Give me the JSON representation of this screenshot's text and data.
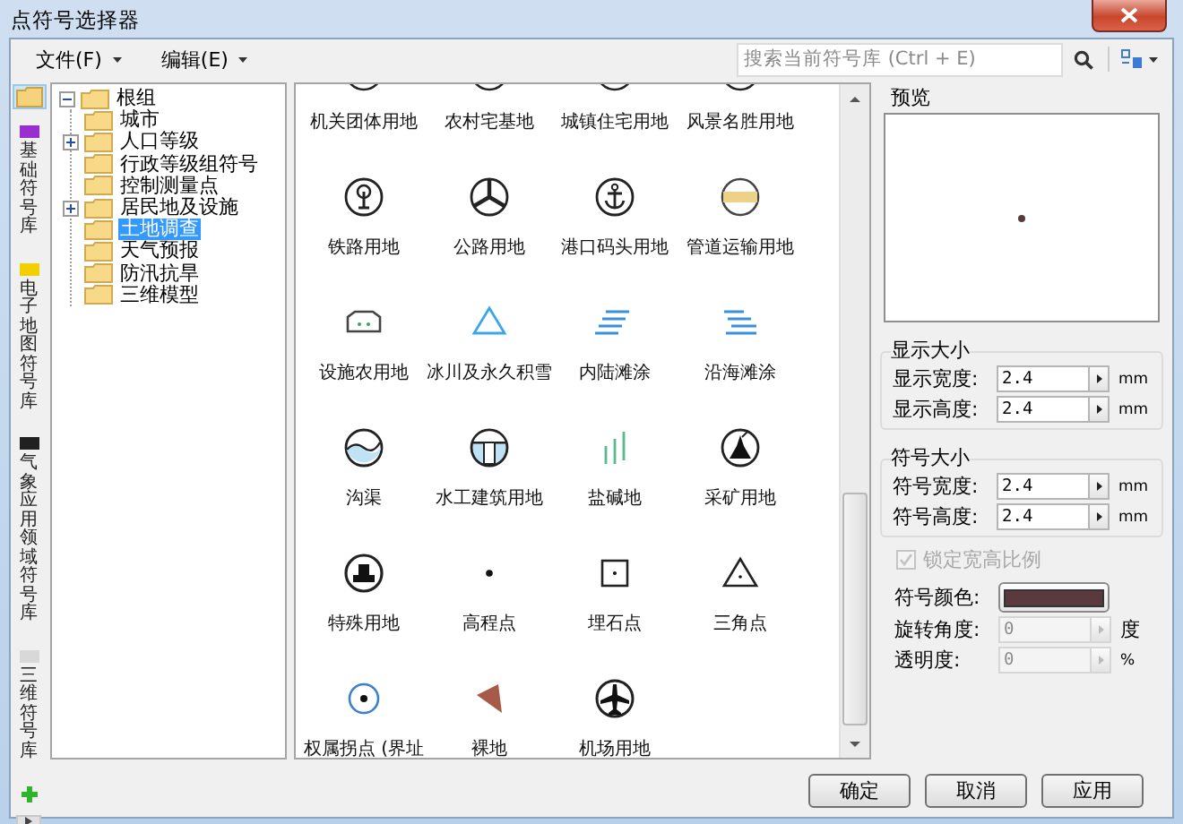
{
  "window": {
    "title": "点符号选择器"
  },
  "menu": [
    {
      "label": "文件(F)"
    },
    {
      "label": "编辑(E)"
    }
  ],
  "search": {
    "placeholder": "搜索当前符号库 (Ctrl + E)"
  },
  "folder_button": {
    "selected": true
  },
  "library_tabs": [
    {
      "label": "基础符号库",
      "color": "#9a2fd0",
      "selected": false
    },
    {
      "label": "电子地图符号库",
      "color": "#f2d000",
      "selected": false
    },
    {
      "label": "气象应用领域符号库",
      "color": "#202020",
      "selected": false
    },
    {
      "label": "三维符号库",
      "color": "#d8d8d8",
      "selected": false
    }
  ],
  "tree": {
    "label": "根组",
    "expanded": true,
    "selected": false,
    "children": [
      {
        "label": "城市",
        "kind": "leaf",
        "selected": false
      },
      {
        "label": "人口等级",
        "kind": "group",
        "selected": false
      },
      {
        "label": "行政等级组符号",
        "kind": "leaf",
        "selected": false
      },
      {
        "label": "控制测量点",
        "kind": "leaf",
        "selected": false
      },
      {
        "label": "居民地及设施",
        "kind": "group",
        "selected": false
      },
      {
        "label": "土地调查",
        "kind": "leaf",
        "selected": true
      },
      {
        "label": "天气预报",
        "kind": "leaf",
        "selected": false
      },
      {
        "label": "防汛抗旱",
        "kind": "leaf",
        "selected": false
      },
      {
        "label": "三维模型",
        "kind": "leaf",
        "selected": false
      }
    ]
  },
  "symbols": [
    {
      "label": "机关团体用地",
      "kind": "cut"
    },
    {
      "label": "农村宅基地",
      "kind": "cut"
    },
    {
      "label": "城镇住宅用地",
      "kind": "cut"
    },
    {
      "label": "风景名胜用地",
      "kind": "cut"
    },
    {
      "label": "铁路用地",
      "kind": "rail"
    },
    {
      "label": "公路用地",
      "kind": "road"
    },
    {
      "label": "港口码头用地",
      "kind": "port"
    },
    {
      "label": "管道运输用地",
      "kind": "pipe"
    },
    {
      "label": "设施农用地",
      "kind": "greenhouse"
    },
    {
      "label": "冰川及永久积雪",
      "kind": "glacier"
    },
    {
      "label": "内陆滩涂",
      "kind": "inland"
    },
    {
      "label": "沿海滩涂",
      "kind": "coastal"
    },
    {
      "label": "沟渠",
      "kind": "ditch"
    },
    {
      "label": "水工建筑用地",
      "kind": "hydraulic"
    },
    {
      "label": "盐碱地",
      "kind": "saline"
    },
    {
      "label": "采矿用地",
      "kind": "mining"
    },
    {
      "label": "特殊用地",
      "kind": "special"
    },
    {
      "label": "高程点",
      "kind": "elevation"
    },
    {
      "label": "埋石点",
      "kind": "stone"
    },
    {
      "label": "三角点",
      "kind": "triangle"
    },
    {
      "label": "权属拐点 (界址",
      "kind": "ownership"
    },
    {
      "label": "裸地",
      "kind": "bare"
    },
    {
      "label": "机场用地",
      "kind": "airport"
    }
  ],
  "properties": {
    "preview_title": "预览",
    "groups": [
      {
        "title": "显示大小",
        "fields": [
          {
            "label": "显示宽度:",
            "value": "2.4",
            "unit": "mm",
            "disabled": false
          },
          {
            "label": "显示高度:",
            "value": "2.4",
            "unit": "mm",
            "disabled": false
          }
        ]
      },
      {
        "title": "符号大小",
        "fields": [
          {
            "label": "符号宽度:",
            "value": "2.4",
            "unit": "mm",
            "disabled": false
          },
          {
            "label": "符号高度:",
            "value": "2.4",
            "unit": "mm",
            "disabled": false
          }
        ]
      }
    ],
    "lock_ratio": {
      "label": "锁定宽高比例",
      "checked": true,
      "disabled": true
    },
    "symbol_color": {
      "label": "符号颜色:",
      "color": "#5a3a3e"
    },
    "fields": [
      {
        "label": "旋转角度:",
        "value": "0",
        "unit": "度",
        "disabled": true
      },
      {
        "label": "透明度:",
        "value": "0",
        "unit": "%",
        "disabled": true
      }
    ]
  },
  "buttons": [
    {
      "label": "确定"
    },
    {
      "label": "取消"
    },
    {
      "label": "应用"
    }
  ]
}
